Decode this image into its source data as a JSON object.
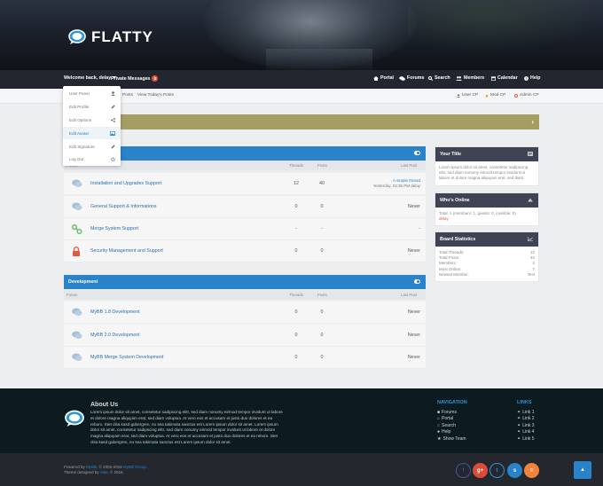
{
  "header": {
    "site_name": "FLATTY"
  },
  "topnav": {
    "welcome": "Welcome back, delay",
    "private_messages": "Private Messages",
    "pm_count": "0",
    "links": [
      "Portal",
      "Forums",
      "Search",
      "Members",
      "Calendar",
      "Help"
    ]
  },
  "subbar": {
    "left_links": [
      "Posts",
      "View Today's Posts"
    ],
    "user_cp": "User CP",
    "mod_cp": "Mod CP",
    "admin_cp": "Admin CP"
  },
  "dropdown": {
    "items": [
      {
        "label": "User Panel",
        "icon": "user-icon"
      },
      {
        "label": "Edit Profile",
        "icon": "pencil-icon"
      },
      {
        "label": "Edit Options",
        "icon": "share-icon"
      },
      {
        "label": "Edit Avatar",
        "icon": "image-icon"
      },
      {
        "label": "Edit Signature",
        "icon": "pencil-icon"
      },
      {
        "label": "Log Out",
        "icon": "power-icon"
      }
    ]
  },
  "categories": [
    {
      "title": "",
      "col_forum": "Forum",
      "col_threads": "Threads",
      "col_posts": "Posts",
      "col_last": "Last Post",
      "forums": [
        {
          "name": "Installation and Upgrades Support",
          "icon": "chat-icon",
          "threads": "12",
          "posts": "40",
          "last_post_thread": "A simple thread",
          "last_post_meta": "Yesterday, 04:35 PM  delay"
        },
        {
          "name": "General Support & Informations",
          "icon": "chat-icon",
          "threads": "0",
          "posts": "0",
          "last_post": "Never"
        },
        {
          "name": "Merge System Support",
          "icon": "link-icon",
          "threads": "-",
          "posts": "-",
          "last_post": "-"
        },
        {
          "name": "Security Management and Support",
          "icon": "lock-icon",
          "threads": "0",
          "posts": "0",
          "last_post": "Never"
        }
      ]
    },
    {
      "title": "Development",
      "col_forum": "Forum",
      "col_threads": "Threads",
      "col_posts": "Posts",
      "col_last": "Last Post",
      "forums": [
        {
          "name": "MyBB 1.8 Development",
          "icon": "chat-icon",
          "threads": "0",
          "posts": "0",
          "last_post": "Never"
        },
        {
          "name": "MyBB 2.0 Development",
          "icon": "chat-icon",
          "threads": "0",
          "posts": "0",
          "last_post": "Never"
        },
        {
          "name": "MyBB Merge System Development",
          "icon": "chat-icon",
          "threads": "0",
          "posts": "0",
          "last_post": "Never"
        }
      ]
    }
  ],
  "sidebar": {
    "your_title": {
      "heading": "Your Title",
      "text": "Lorem ipsum dolor sit amet, consetetur sadipscing elitr, sed diam nonumy eirmod tempor invidunt ut labore et dolore magna aliquyam erat, sed diam."
    },
    "whos_online": {
      "heading": "Who's Online",
      "text": "Total: 1 (members: 1, guests: 0, invisible: 0)",
      "user": "delay"
    },
    "board_stats": {
      "heading": "Board Statistics",
      "rows": [
        {
          "label": "Total Threads:",
          "value": "12"
        },
        {
          "label": "Total Posts:",
          "value": "40"
        },
        {
          "label": "Members:",
          "value": "2"
        },
        {
          "label": "Most Online:",
          "value": "7"
        },
        {
          "label": "Newest Member:",
          "value": "Test"
        }
      ]
    }
  },
  "footer": {
    "about_title": "About Us",
    "about_text": "Lorem ipsum dolor sit amet, consetetur sadipscing elitr, sed diam nonumy eirmod tempor invidunt ut labore et dolore magna aliquyam erat, sed diam voluptua. At vero eos et accusam et justo duo dolores et ea rebum. Stet clita kasd gubergren, no sea takimata sanctus est Lorem ipsum dolor sit amet. Lorem ipsum dolor sit amet, consetetur sadipscing elitr, sed diam nonumy eirmod tempor invidunt ut labore et dolore magna aliquyam erat, sed diam voluptua. At vero eos et accusam et justo duo dolores et ea rebum. Stet clita kasd gubergren, no sea takimata sanctus est Lorem ipsum dolor sit amet.",
    "navigation_title": "NAVIGATION",
    "navigation": [
      {
        "label": "Forums",
        "icon": "chat-icon"
      },
      {
        "label": "Portal",
        "icon": "home-icon"
      },
      {
        "label": "Search",
        "icon": "search-icon"
      },
      {
        "label": "Help",
        "icon": "help-icon"
      },
      {
        "label": "Show Team",
        "icon": "star-icon"
      }
    ],
    "links_title": "LINKS",
    "links": [
      "Link 1",
      "Link 2",
      "Link 3",
      "Link 4",
      "Link 5"
    ]
  },
  "bottom": {
    "powered_prefix": "Powered by",
    "powered_link": "MyBB",
    "copyright": ", © 2002-2016",
    "group_link": "MyBB Group",
    "theme_prefix": "Theme designed by",
    "theme_link": "Vale",
    "theme_year": ", © 2016."
  },
  "colors": {
    "accent_blue": "#2a82c8",
    "olive_bar": "#a59e63",
    "dark_header": "#3f4454",
    "badge_red": "#e2593d"
  }
}
